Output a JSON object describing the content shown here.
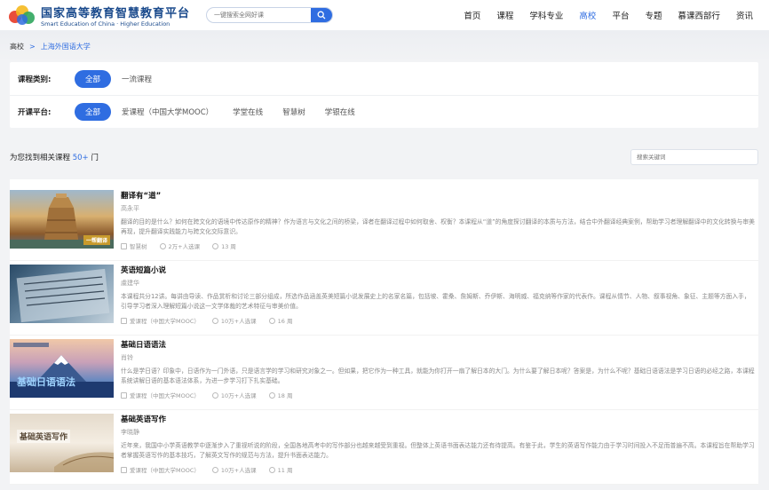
{
  "header": {
    "logo_cn": "国家高等教育智慧教育平台",
    "logo_en": "Smart Education of China · Higher Education",
    "search_placeholder": "一键搜索全网好课",
    "nav": [
      {
        "label": "首页",
        "active": false
      },
      {
        "label": "课程",
        "active": false
      },
      {
        "label": "学科专业",
        "active": false
      },
      {
        "label": "高校",
        "active": true
      },
      {
        "label": "平台",
        "active": false
      },
      {
        "label": "专题",
        "active": false
      },
      {
        "label": "慕课西部行",
        "active": false
      },
      {
        "label": "资讯",
        "active": false
      }
    ]
  },
  "breadcrumb": {
    "root": "高校",
    "separator": ">",
    "current": "上海外国语大学"
  },
  "filters": {
    "category_label": "课程类别:",
    "category_options": [
      {
        "label": "全部",
        "active": true
      },
      {
        "label": "一流课程",
        "active": false
      }
    ],
    "platform_label": "开课平台:",
    "platform_options": [
      {
        "label": "全部",
        "active": true
      },
      {
        "label": "爱课程（中国大学MOOC）",
        "active": false
      },
      {
        "label": "学堂在线",
        "active": false
      },
      {
        "label": "智慧树",
        "active": false
      },
      {
        "label": "学银在线",
        "active": false
      }
    ]
  },
  "results": {
    "prefix": "为您找到相关课程",
    "count": "50+",
    "suffix": "门",
    "keyword_placeholder": "搜索关键词"
  },
  "courses": [
    {
      "title": "翻译有“道”",
      "teacher": "高永平",
      "desc": "翻译的目的是什么？如何在跨文化的语境中传达原作的精神？作为语言与文化之间的桥梁，译者在翻译过程中如何取舍、权衡？本课程从“道”的角度探讨翻译的本质与方法，结合中外翻译经典案例，帮助学习者理解翻译中的文化转换与审美再现，提升翻译实践能力与跨文化交际意识。",
      "platform": "智慧树",
      "enrolled": "2万+人选课",
      "hours": "13 周",
      "thumb_caption": "一帮翻译",
      "thumb_colors": [
        "#d8b070",
        "#8a5a2c",
        "#4a6a8c"
      ]
    },
    {
      "title": "英语短篇小说",
      "teacher": "虞建华",
      "desc": "本课程共分12讲。每讲由导读、作品赏析和讨论三部分组成，所选作品涵盖英美短篇小说发展史上的名家名篇，包括坡、霍桑、詹姆斯、乔伊斯、海明威、福克纳等作家的代表作。课程从情节、人物、叙事视角、象征、主题等方面入手，引导学习者深入理解短篇小说这一文学体裁的艺术特征与审美价值。",
      "platform": "爱课程（中国大学MOOC）",
      "enrolled": "10万+人选课",
      "hours": "16 周",
      "thumb_caption": "",
      "thumb_colors": [
        "#4f6f8a",
        "#9fb5c4",
        "#2a4a66"
      ]
    },
    {
      "title": "基础日语语法",
      "teacher": "肖铃",
      "desc": "什么是学日语？印象中，日语作为一门外语，只是语言学的学习和研究对象之一。但如果，把它作为一种工具，就能为你打开一扇了解日本的大门。为什么要了解日本呢？答案是，为什么不呢？基础日语语法是学习日语的必经之路，本课程系统讲解日语的基本语法体系，为进一步学习打下扎实基础。",
      "platform": "爱课程（中国大学MOOC）",
      "enrolled": "10万+人选课",
      "hours": "18 周",
      "thumb_caption": "基础日语语法",
      "thumb_colors": [
        "#2a4a80",
        "#f0c0a0",
        "#6a8ac0"
      ]
    },
    {
      "title": "基础英语写作",
      "teacher": "李晓静",
      "desc": "近年来，我国中小学英语教学中逐渐步入了重视听说的阶段，全国各地高考中的写作部分也越来越受到重视。但整体上英语书面表达能力还有待提高。有鉴于此，学生的英语写作能力由于学习时间投入不足而普遍不高。本课程旨在帮助学习者掌握英语写作的基本技巧，了解英文写作的规范与方法，提升书面表达能力。",
      "platform": "爱课程（中国大学MOOC）",
      "enrolled": "10万+人选课",
      "hours": "11 周",
      "thumb_caption": "基础英语写作",
      "thumb_colors": [
        "#d8cbb8",
        "#f4ede2",
        "#a89070"
      ]
    }
  ]
}
